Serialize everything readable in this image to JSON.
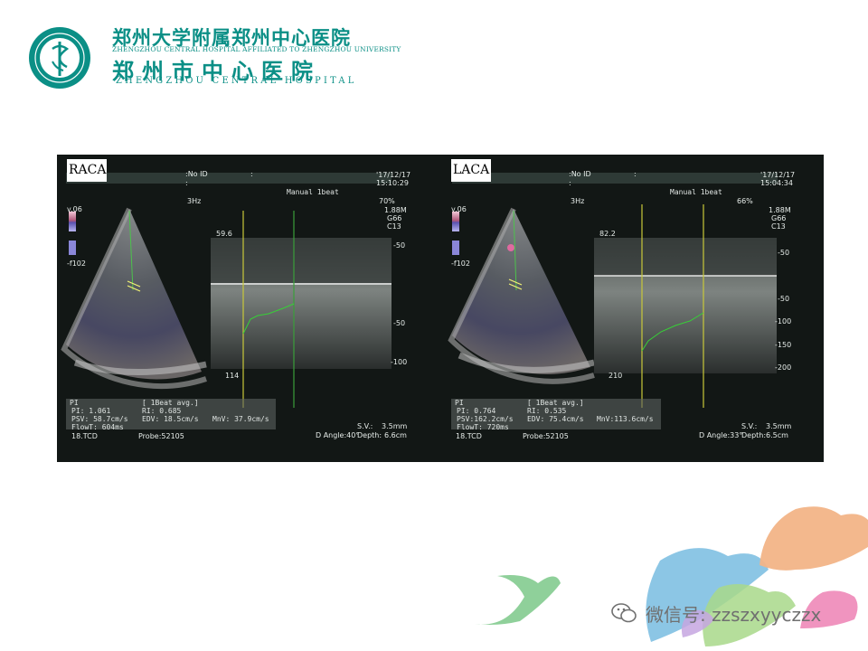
{
  "header": {
    "hospital_cn_line1": "郑州大学附属郑州中心医院",
    "hospital_en_line1": "ZHENGZHOU CENTRAL HOSPITAL AFFILIATED TO ZHENGZHOU UNIVERSITY",
    "hospital_cn_line2": "郑州市中心医院",
    "hospital_en_line2": "ZHENGZHOU CENTRAL HOSPITAL",
    "logo_icon": "hospital-emblem-icon",
    "brand_color": "#0b8f86"
  },
  "panels": [
    {
      "vessel_label": "RACA",
      "patient": ":No ID",
      "colon2": ":",
      "colon3": ":",
      "date": "'17/12/17",
      "time": "15:10:29",
      "mode": "Manual  1beat",
      "freq": "3Hz",
      "gain_pct": "70%",
      "probe_freq": "1.88M",
      "g": "G66",
      "c": "C13",
      "color_top": "v.06",
      "color_bottom": "-f102",
      "scale_max": "59.6",
      "scale_marks": [
        "-50",
        "-50",
        "-100"
      ],
      "bottom_value": "114",
      "pi_header": "PI",
      "avg_note": "[ 1Beat avg.]",
      "pi": "PI: 1.061",
      "ri": "RI: 0.685",
      "psv": "PSV: 58.7cm/s",
      "edv": "EDV: 18.5cm/s",
      "mnv": "MnV: 37.9cm/s",
      "flowt": "FlowT: 604ms",
      "preset": "18.TCD",
      "probe": "Probe:52105",
      "sv": "S.V.:",
      "sv_val": "3.5mm",
      "angle": "D Angle:40°",
      "depth": "Depth:",
      "depth_val": "6.6cm"
    },
    {
      "vessel_label": "LACA",
      "patient": ":No ID",
      "colon2": ":",
      "colon3": ":",
      "date": "'17/12/17",
      "time": "15:04:34",
      "mode": "Manual  1beat",
      "freq": "3Hz",
      "gain_pct": "66%",
      "probe_freq": "1.88M",
      "g": "G66",
      "c": "C13",
      "color_top": "v.06",
      "color_bottom": "-f102",
      "scale_max": "82.2",
      "scale_marks": [
        "-50",
        "-50",
        "-100",
        "-150",
        "-200"
      ],
      "bottom_value": "210",
      "pi_header": "PI",
      "avg_note": "[ 1Beat avg.]",
      "pi": "PI: 0.764",
      "ri": "RI: 0.535",
      "psv": "PSV:162.2cm/s",
      "edv": "EDV: 75.4cm/s",
      "mnv": "MnV:113.6cm/s",
      "flowt": "FlowT: 720ms",
      "preset": "18.TCD",
      "probe": "Probe:52105",
      "sv": "S.V.:",
      "sv_val": "3.5mm",
      "angle": "D Angle:33°",
      "depth": "Depth:",
      "depth_val": "6.5cm"
    }
  ],
  "footer": {
    "wechat_text": "微信号: zzszxyyczzx",
    "wechat_icon": "wechat-icon",
    "decor_icon": "ginkgo-leaves-decoration"
  }
}
